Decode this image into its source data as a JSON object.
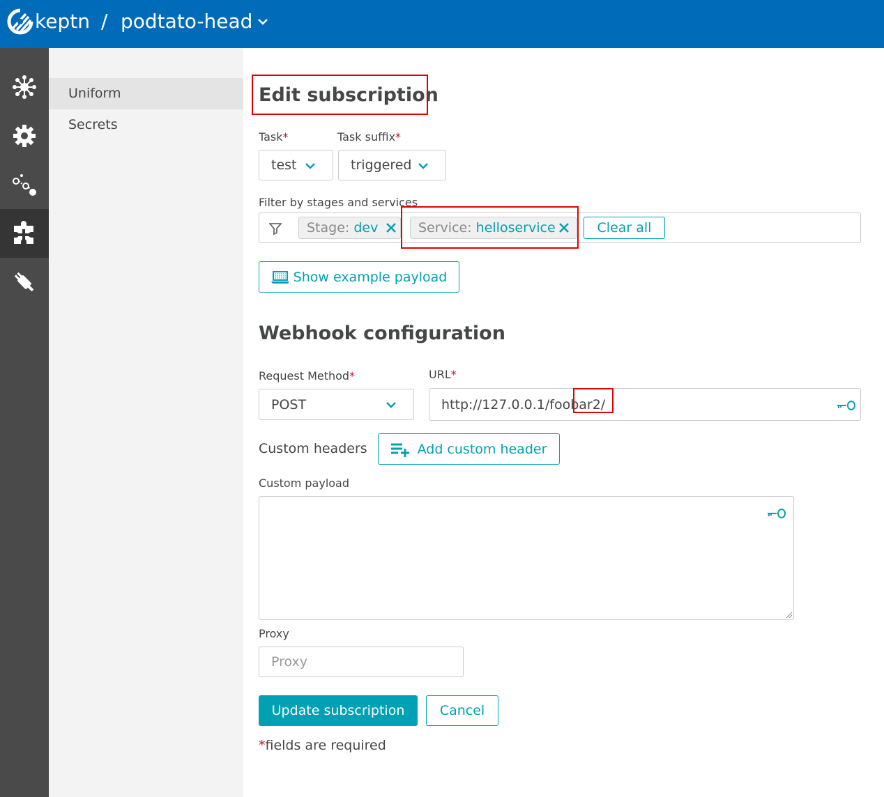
{
  "header": {
    "brand": "keptn",
    "separator": "/",
    "project": "podtato-head"
  },
  "sidebar": {
    "icons": [
      "environment-icon",
      "settings-gear-icon",
      "sequences-icon",
      "integrations-puzzle-icon",
      "service-plug-icon"
    ],
    "active_index": 3
  },
  "submenu": {
    "items": [
      {
        "label": "Uniform",
        "active": true
      },
      {
        "label": "Secrets",
        "active": false
      }
    ]
  },
  "form": {
    "title": "Edit subscription",
    "task_label": "Task",
    "task_value": "test",
    "task_suffix_label": "Task suffix",
    "task_suffix_value": "triggered",
    "filter_label": "Filter by stages and services",
    "filter_chips": [
      {
        "key": "Stage: ",
        "value": "dev"
      },
      {
        "key": "Service: ",
        "value": "helloservice"
      }
    ],
    "clear_all": "Clear all",
    "show_payload": "Show example payload",
    "webhook_title": "Webhook configuration",
    "method_label": "Request Method",
    "method_value": "POST",
    "url_label": "URL",
    "url_value": "http://127.0.0.1/foobar2/",
    "custom_headers_label": "Custom headers",
    "add_header": "Add custom header",
    "payload_label": "Custom payload",
    "payload_value": "",
    "proxy_label": "Proxy",
    "proxy_placeholder": "Proxy",
    "update_button": "Update subscription",
    "cancel_button": "Cancel",
    "required_mark": "*",
    "required_note": "fields are required"
  },
  "colors": {
    "topbar": "#006bb8",
    "accent": "#00a1b2",
    "sidenav": "#4a4a4a",
    "required": "#c41425",
    "highlight": "#e00000"
  }
}
